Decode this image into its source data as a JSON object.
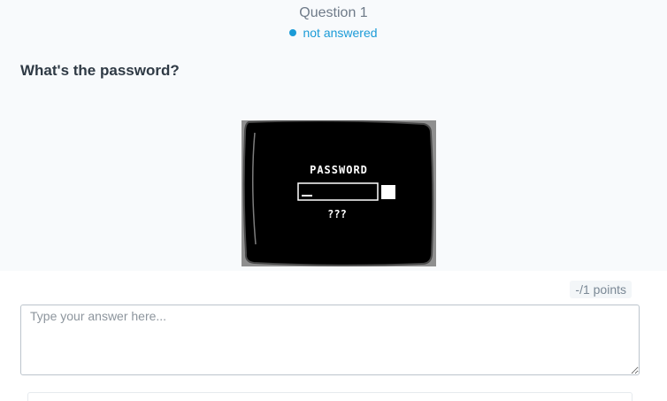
{
  "question": {
    "number_label": "Question 1",
    "status": "not answered",
    "prompt": "What's the password?",
    "points": "-/1 points"
  },
  "image": {
    "heading": "PASSWORD",
    "hint": "???"
  },
  "answer": {
    "placeholder": "Type your answer here...",
    "value": ""
  },
  "colors": {
    "status_accent": "#1b9bd7",
    "panel_background": "#f8fafc"
  }
}
